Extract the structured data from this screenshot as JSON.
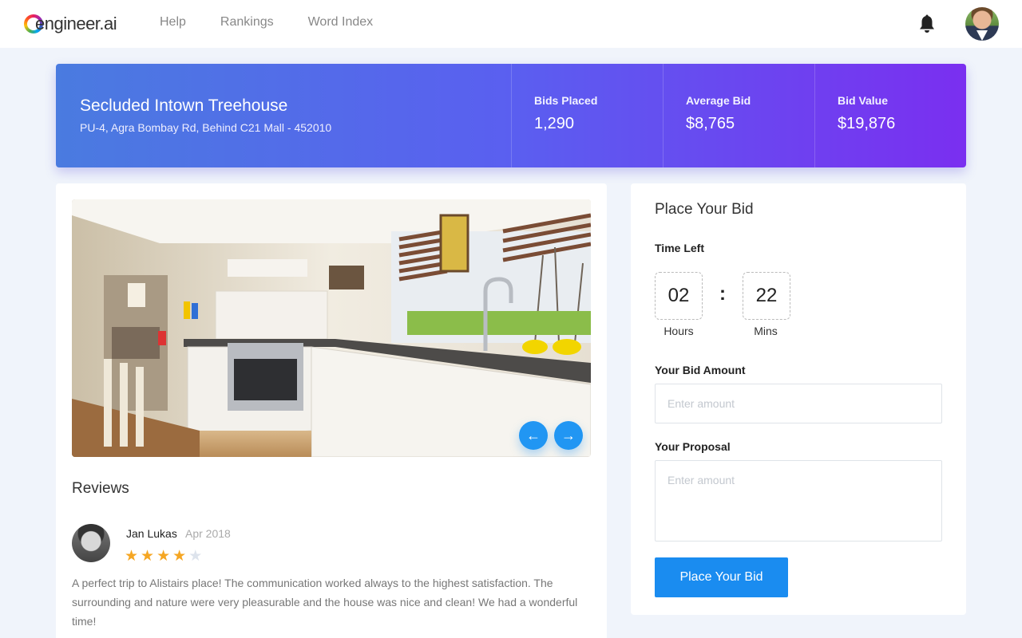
{
  "header": {
    "logo_text": "engineer.ai",
    "nav": [
      {
        "label": "Help"
      },
      {
        "label": "Rankings"
      },
      {
        "label": "Word Index"
      }
    ],
    "icons": {
      "notifications": "bell-icon",
      "profile": "avatar"
    }
  },
  "listing": {
    "title": "Secluded Intown Treehouse",
    "address": "PU-4, Agra Bombay Rd, Behind C21 Mall - 452010",
    "stats": [
      {
        "label": "Bids Placed",
        "value": "1,290"
      },
      {
        "label": "Average Bid",
        "value": "$8,765"
      },
      {
        "label": "Bid Value",
        "value": "$19,876"
      }
    ]
  },
  "gallery": {
    "prev_icon": "←",
    "next_icon": "→"
  },
  "reviews": {
    "title": "Reviews",
    "items": [
      {
        "name": "Jan Lukas",
        "date": "Apr 2018",
        "rating": 4,
        "max_rating": 5,
        "text": "A perfect trip to Alistairs place! The communication worked always to the highest satisfaction. The surrounding and nature were very pleasurable and the house was nice and clean! We had a wonderful time!"
      }
    ]
  },
  "bid_form": {
    "title": "Place Your Bid",
    "time_left_label": "Time Left",
    "hours": "02",
    "hours_label": "Hours",
    "separator": ":",
    "mins": "22",
    "mins_label": "Mins",
    "amount_label": "Your Bid Amount",
    "amount_placeholder": "Enter amount",
    "proposal_label": "Your Proposal",
    "proposal_placeholder": "Enter amount",
    "submit_label": "Place Your Bid"
  },
  "colors": {
    "banner_start": "#4a7be0",
    "banner_end": "#7a2ff0",
    "primary_button": "#1a8cf0",
    "star": "#f5a623"
  }
}
